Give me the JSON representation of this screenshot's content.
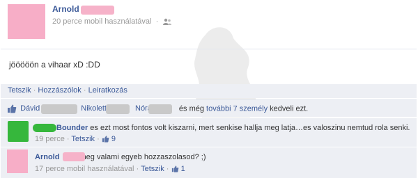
{
  "post": {
    "author": "Arnold",
    "time": "20 perce",
    "source": "mobil használatával",
    "privacy_sep": "·",
    "text": "jööööön a vihaar xD :DD"
  },
  "actions": {
    "like": "Tetszik",
    "comment": "Hozzászólok",
    "unsubscribe": "Leiratkozás",
    "sep": "·"
  },
  "likes": {
    "names": [
      "Dávid",
      "Nikolett",
      "Nóra"
    ],
    "and_more": "és még",
    "more_link": "további 7 személy",
    "suffix": "kedveli ezt."
  },
  "comments": [
    {
      "author": "Bounder",
      "text": "es ezt most fontos volt kiszarni, mert senkise hallja meg latja…es valoszinu nemtud rola senki.",
      "time": "19 perce",
      "like_label": "Tetszik",
      "like_count": "9",
      "avatar_color": "#36b73c"
    },
    {
      "author": "Arnold",
      "text": "meg valami egyeb hozzaszolasod? ;)",
      "time": "17 perce",
      "source": "mobil használatával",
      "like_label": "Tetszik",
      "like_count": "1",
      "avatar_color": "#f7aec7"
    }
  ],
  "colors": {
    "link": "#3b5998",
    "meta": "#999999",
    "strip": "#edeff4",
    "redaction_pink": "#f6b2c9",
    "redaction_gray": "#c9c9c9"
  }
}
